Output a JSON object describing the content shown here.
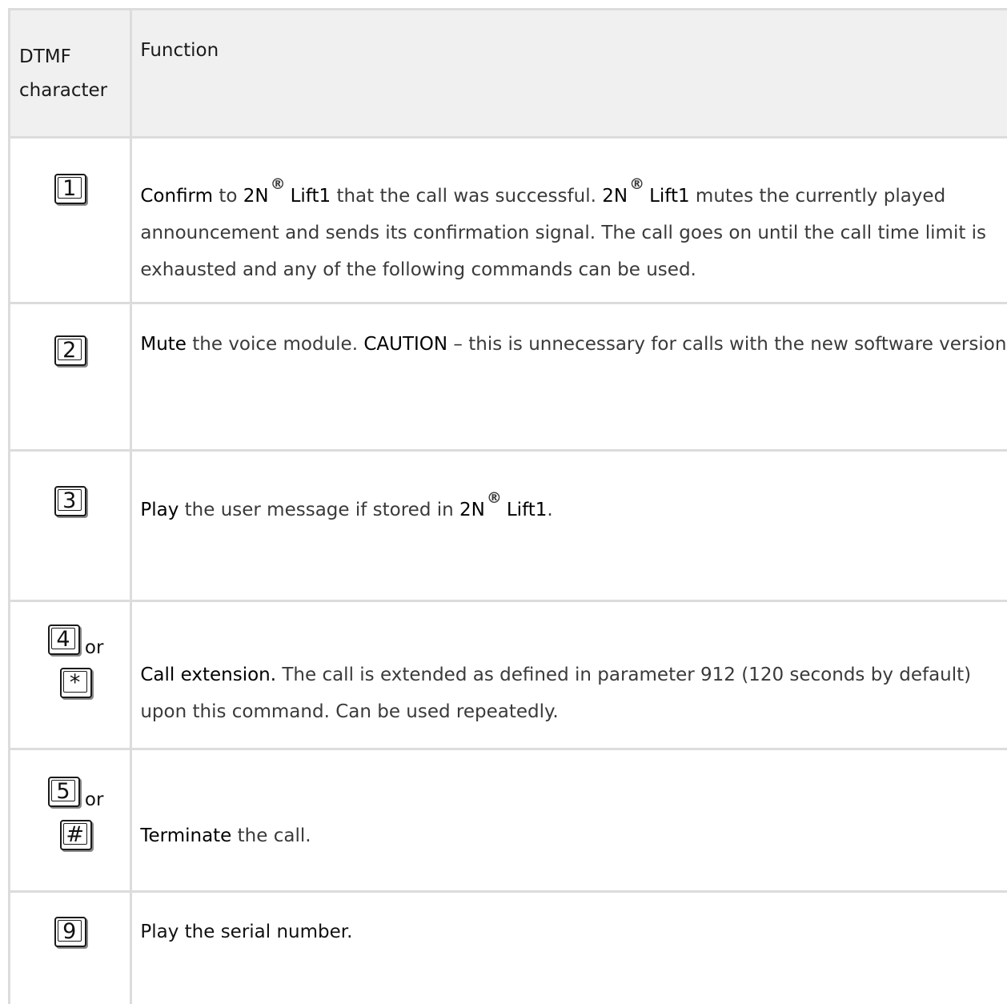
{
  "header": {
    "col1": "DTMF character",
    "col1_line1": "DTMF",
    "col1_line2": "character",
    "col2": "Function"
  },
  "registered_mark": "®",
  "rows": [
    {
      "keys": [
        "1"
      ],
      "text": {
        "confirm": "Confirm",
        "t1": " to ",
        "brand_a": "2N",
        "product_a": "Lift1",
        "t2": " that the call was successful. ",
        "brand_b": "2N",
        "product_b": "Lift1",
        "t3": " mutes the currently played announcement and sends its confirmation signal. The call goes on until the call time limit is exhausted and any of the following commands can be used."
      }
    },
    {
      "keys": [
        "2"
      ],
      "text": {
        "mute": "Mute",
        "t1": " the voice module. ",
        "caution": "CAUTION",
        "t2": " – this is unnecessary for calls with the new software version."
      }
    },
    {
      "keys": [
        "3"
      ],
      "text": {
        "play": "Play",
        "t1": " the user message if stored in ",
        "brand": "2N",
        "product": "Lift1",
        "t2": "."
      }
    },
    {
      "keys": [
        "4",
        "*"
      ],
      "or": "or",
      "text": {
        "call_ext": "Call extension.",
        "t1": " The call is extended as defined in parameter 912 (120 seconds by default) upon this command. Can be used repeatedly."
      }
    },
    {
      "keys": [
        "5",
        "#"
      ],
      "or": "or",
      "text": {
        "terminate": "Terminate",
        "t1": " the call."
      }
    },
    {
      "keys": [
        "9"
      ],
      "text": {
        "t1": "Play the serial number."
      }
    }
  ]
}
